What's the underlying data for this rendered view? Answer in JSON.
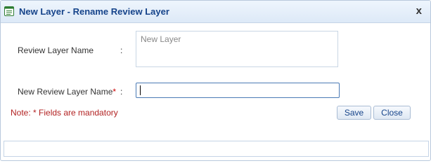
{
  "window": {
    "title": "New Layer - Rename Review Layer",
    "close_glyph": "x"
  },
  "form": {
    "current_label": "Review Layer Name",
    "current_colon": ":",
    "current_value": "New Layer",
    "new_label": "New Review Layer Name",
    "new_required_marker": "*",
    "new_colon": ":",
    "new_value": ""
  },
  "note": "Note: * Fields are mandatory",
  "buttons": {
    "save": "Save",
    "close": "Close"
  },
  "icons": {
    "title_icon": "form-icon",
    "close": "close-icon"
  },
  "colors": {
    "title_text": "#15438a",
    "title_icon": "#2e7d32",
    "note_text": "#b22222",
    "required_marker": "#cc0000"
  }
}
